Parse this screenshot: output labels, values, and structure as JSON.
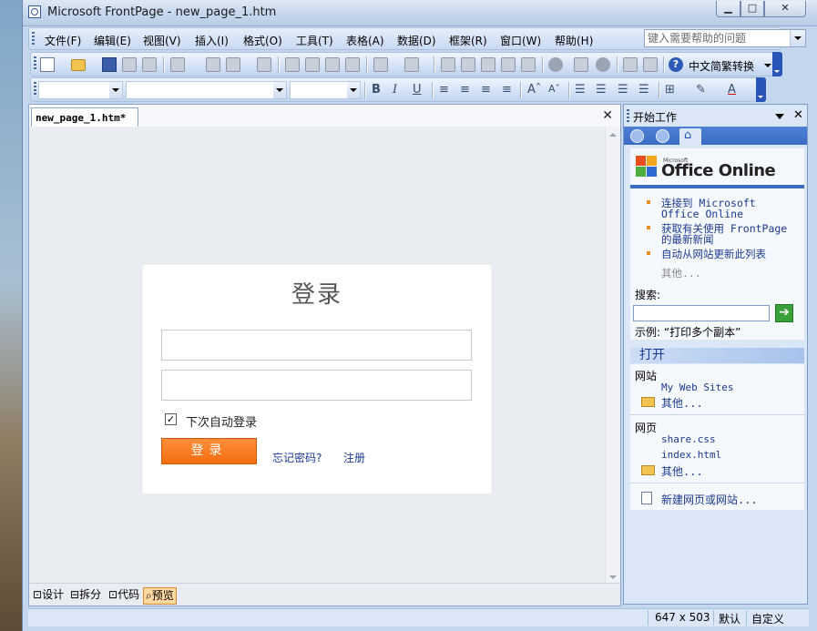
{
  "window": {
    "title": "Microsoft FrontPage - new_page_1.htm"
  },
  "menubar": {
    "items": [
      "文件(F)",
      "编辑(E)",
      "视图(V)",
      "插入(I)",
      "格式(O)",
      "工具(T)",
      "表格(A)",
      "数据(D)",
      "框架(R)",
      "窗口(W)",
      "帮助(H)"
    ],
    "help_placeholder": "键入需要帮助的问题"
  },
  "toolbar": {
    "convert_label": "中文简繁转换"
  },
  "document": {
    "tab_label": "new_page_1.htm*",
    "login": {
      "title": "登录",
      "remember_label": "下次自动登录",
      "remember_checked": true,
      "button_label": "登录",
      "forgot_link": "忘记密码?",
      "register_link": "注册"
    },
    "view_tabs": [
      "设计",
      "拆分",
      "代码",
      "预览"
    ],
    "active_view": "预览"
  },
  "task_pane": {
    "title": "开始工作",
    "brand_small": "Microsoft",
    "brand": "Office Online",
    "links": [
      "连接到 Microsoft Office Online",
      "获取有关使用 FrontPage 的最新新闻",
      "自动从网站更新此列表"
    ],
    "more": "其他...",
    "search_label": "搜索:",
    "example": "示例:  “打印多个副本”",
    "open_section": "打开",
    "site_label": "网站",
    "sites": [
      "My Web Sites"
    ],
    "site_more": "其他...",
    "page_label": "网页",
    "pages": [
      "share.css",
      "index.html"
    ],
    "page_more": "其他...",
    "new_link": "新建网页或网站..."
  },
  "statusbar": {
    "dimensions": "647 x 503",
    "mode": "默认",
    "custom": "自定义"
  },
  "colors": {
    "accent": "#3a6cc4",
    "login_button": "#f56d10"
  }
}
